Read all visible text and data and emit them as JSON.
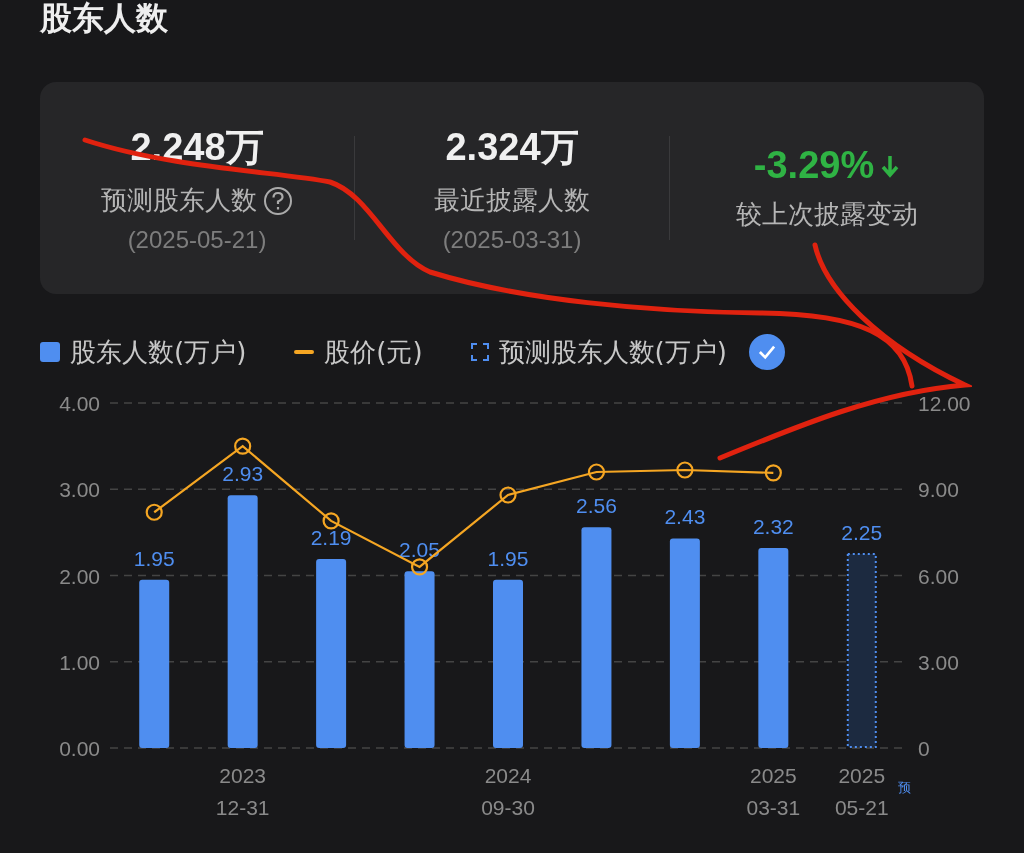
{
  "title": "股东人数",
  "summary": [
    {
      "value": "2.248万",
      "label": "预测股东人数",
      "date": "(2025-05-21)",
      "help": true,
      "falling": false
    },
    {
      "value": "2.324万",
      "label": "最近披露人数",
      "date": "(2025-03-31)",
      "help": false,
      "falling": false
    },
    {
      "value": "-3.29%",
      "label": "较上次披露变动",
      "help": false,
      "falling": true
    }
  ],
  "forecast_toggle": {
    "selected": true
  },
  "charts": [
    {
      "chart_data": {
        "type": "bar",
        "categories": [
          null,
          "2023 12-31",
          null,
          null,
          "2024 09-30",
          null,
          null,
          "2025 03-31",
          "2025 05-21"
        ],
        "ylim": [
          0,
          4
        ],
        "grid": true,
        "yticks": [
          {
            "value": 0,
            "label": "0.00"
          },
          {
            "value": 1,
            "label": "1.00"
          },
          {
            "value": 2,
            "label": "2.00"
          },
          {
            "value": 3,
            "label": "3.00"
          },
          {
            "value": 4,
            "label": "4.00"
          }
        ],
        "series": [
          {
            "name": "股东人数(万户)",
            "color": "#4f8ef0",
            "values": [
              1.95,
              2.93,
              2.19,
              2.05,
              1.95,
              2.56,
              2.43,
              2.32,
              null
            ],
            "value_labels": [
              "1.95",
              "2.93",
              "2.19",
              "2.05",
              "1.95",
              "2.56",
              "2.43",
              "2.32",
              null
            ]
          },
          {
            "name": "预测股东人数(万户)",
            "color": "#4f8ef0",
            "values": [
              null,
              null,
              null,
              null,
              null,
              null,
              null,
              null,
              2.25
            ],
            "value_labels": [
              null,
              null,
              null,
              null,
              null,
              null,
              null,
              null,
              "2.25"
            ]
          }
        ],
        "annotations": [
          "预"
        ]
      }
    },
    {
      "chart_data": {
        "type": "line",
        "categories": [
          null,
          null,
          null,
          null,
          null,
          null,
          null,
          null,
          null
        ],
        "ylim": [
          0,
          12
        ],
        "yticks": [
          {
            "value": 0,
            "label": "0"
          },
          {
            "value": 3,
            "label": "3.00"
          },
          {
            "value": 6,
            "label": "6.00"
          },
          {
            "value": 9,
            "label": "9.00"
          },
          {
            "value": 12,
            "label": "12.00"
          }
        ],
        "series": [
          {
            "name": "股价(元)",
            "color": "#f5a623",
            "marker": "circle",
            "values": [
              8.2,
              10.5,
              7.9,
              6.3,
              8.8,
              9.6,
              9.67,
              9.57,
              null
            ]
          }
        ]
      }
    }
  ]
}
